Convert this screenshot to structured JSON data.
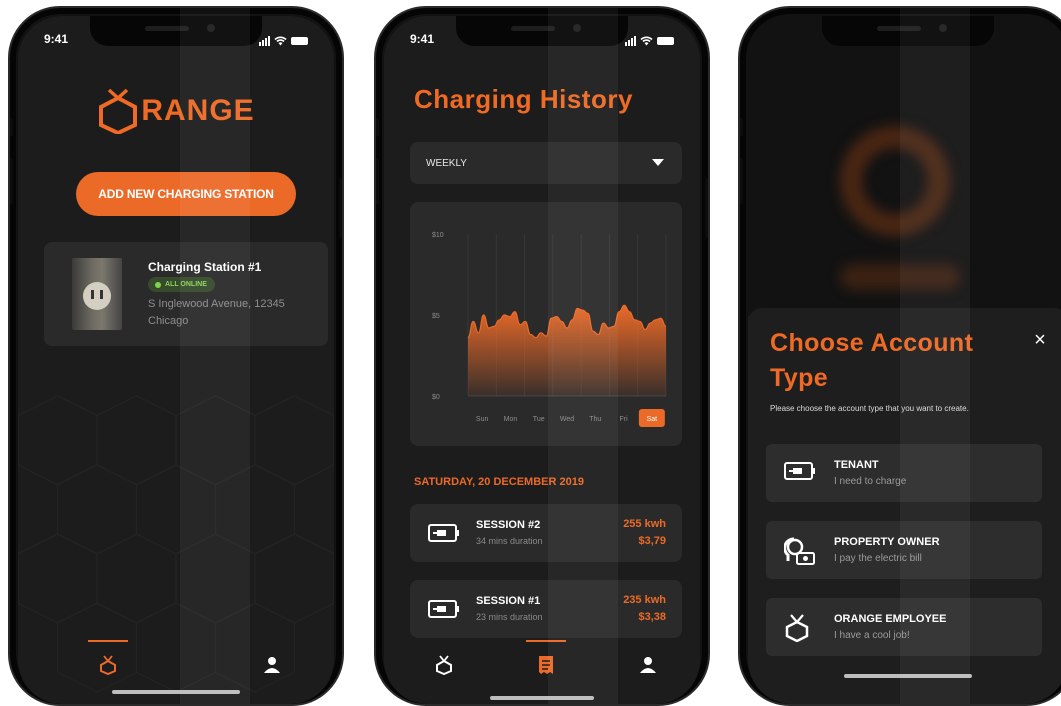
{
  "accent_color": "#ec6a28",
  "status_time": "9:41",
  "screen_home": {
    "logo_text": "RANGE",
    "add_station_label": "ADD NEW CHARGING STATION",
    "station": {
      "name": "Charging Station #1",
      "status": "ALL ONLINE",
      "address_line1": "S Inglewood Avenue, 12345",
      "address_line2": "Chicago"
    },
    "tabs": [
      "orange-logo-icon",
      "user-icon"
    ]
  },
  "screen_history": {
    "title": "Charging History",
    "period_select": "WEEKLY",
    "date_header": "SATURDAY, 20 DECEMBER 2019",
    "sessions": [
      {
        "name": "SESSION #2",
        "duration": "34 mins duration",
        "energy": "255 kwh",
        "cost": "$3,79"
      },
      {
        "name": "SESSION #1",
        "duration": "23 mins duration",
        "energy": "235 kwh",
        "cost": "$3,38"
      }
    ],
    "tabs": [
      "orange-logo-icon",
      "receipt-icon",
      "user-icon"
    ]
  },
  "chart_data": {
    "type": "area",
    "categories": [
      "Sun",
      "Mon",
      "Tue",
      "Wed",
      "Thu",
      "Fri",
      "Sat"
    ],
    "selected_category": "Sat",
    "y_tick_labels": [
      "$10",
      "$5",
      "$0"
    ],
    "ylim": [
      0,
      10
    ],
    "series": [
      {
        "values": [
          3.6,
          4.6,
          3.9,
          5.0,
          4.2,
          4.3,
          4.7,
          5.0,
          4.9,
          5.2,
          4.4,
          4.6,
          3.8,
          3.6,
          3.9,
          3.7,
          4.8,
          4.9,
          4.6,
          4.2,
          4.7,
          5.4,
          5.3,
          5.1,
          4.0,
          3.8,
          4.5,
          4.2,
          4.3,
          5.2,
          5.6,
          5.2,
          4.7,
          4.6,
          4.1,
          4.5,
          4.7,
          4.8,
          4.3
        ]
      }
    ],
    "grid": true
  },
  "screen_account": {
    "title_line1": "Choose Account",
    "title_line2": "Type",
    "subtitle": "Please choose the account type that you want to create.",
    "options": [
      {
        "title": "TENANT",
        "subtitle": "I need to charge",
        "icon": "plug-icon"
      },
      {
        "title": "PROPERTY OWNER",
        "subtitle": "I pay the electric bill",
        "icon": "owner-icon"
      },
      {
        "title": "ORANGE EMPLOYEE",
        "subtitle": "I have a cool job!",
        "icon": "orange-logo-icon"
      }
    ],
    "close_label": "×"
  }
}
